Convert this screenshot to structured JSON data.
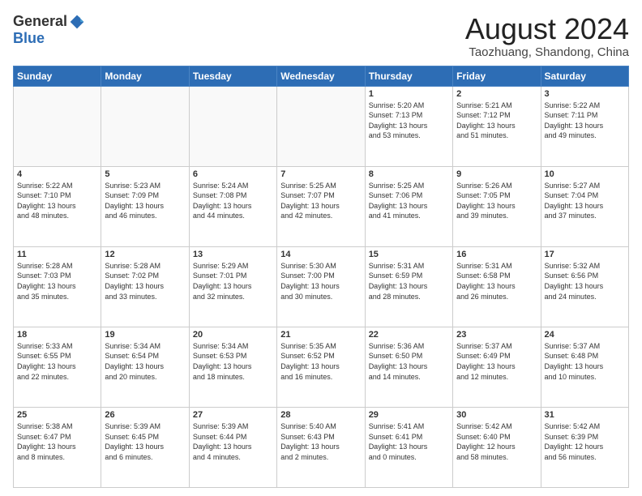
{
  "logo": {
    "general": "General",
    "blue": "Blue"
  },
  "title": "August 2024",
  "subtitle": "Taozhuang, Shandong, China",
  "headers": [
    "Sunday",
    "Monday",
    "Tuesday",
    "Wednesday",
    "Thursday",
    "Friday",
    "Saturday"
  ],
  "weeks": [
    [
      {
        "day": "",
        "info": ""
      },
      {
        "day": "",
        "info": ""
      },
      {
        "day": "",
        "info": ""
      },
      {
        "day": "",
        "info": ""
      },
      {
        "day": "1",
        "info": "Sunrise: 5:20 AM\nSunset: 7:13 PM\nDaylight: 13 hours\nand 53 minutes."
      },
      {
        "day": "2",
        "info": "Sunrise: 5:21 AM\nSunset: 7:12 PM\nDaylight: 13 hours\nand 51 minutes."
      },
      {
        "day": "3",
        "info": "Sunrise: 5:22 AM\nSunset: 7:11 PM\nDaylight: 13 hours\nand 49 minutes."
      }
    ],
    [
      {
        "day": "4",
        "info": "Sunrise: 5:22 AM\nSunset: 7:10 PM\nDaylight: 13 hours\nand 48 minutes."
      },
      {
        "day": "5",
        "info": "Sunrise: 5:23 AM\nSunset: 7:09 PM\nDaylight: 13 hours\nand 46 minutes."
      },
      {
        "day": "6",
        "info": "Sunrise: 5:24 AM\nSunset: 7:08 PM\nDaylight: 13 hours\nand 44 minutes."
      },
      {
        "day": "7",
        "info": "Sunrise: 5:25 AM\nSunset: 7:07 PM\nDaylight: 13 hours\nand 42 minutes."
      },
      {
        "day": "8",
        "info": "Sunrise: 5:25 AM\nSunset: 7:06 PM\nDaylight: 13 hours\nand 41 minutes."
      },
      {
        "day": "9",
        "info": "Sunrise: 5:26 AM\nSunset: 7:05 PM\nDaylight: 13 hours\nand 39 minutes."
      },
      {
        "day": "10",
        "info": "Sunrise: 5:27 AM\nSunset: 7:04 PM\nDaylight: 13 hours\nand 37 minutes."
      }
    ],
    [
      {
        "day": "11",
        "info": "Sunrise: 5:28 AM\nSunset: 7:03 PM\nDaylight: 13 hours\nand 35 minutes."
      },
      {
        "day": "12",
        "info": "Sunrise: 5:28 AM\nSunset: 7:02 PM\nDaylight: 13 hours\nand 33 minutes."
      },
      {
        "day": "13",
        "info": "Sunrise: 5:29 AM\nSunset: 7:01 PM\nDaylight: 13 hours\nand 32 minutes."
      },
      {
        "day": "14",
        "info": "Sunrise: 5:30 AM\nSunset: 7:00 PM\nDaylight: 13 hours\nand 30 minutes."
      },
      {
        "day": "15",
        "info": "Sunrise: 5:31 AM\nSunset: 6:59 PM\nDaylight: 13 hours\nand 28 minutes."
      },
      {
        "day": "16",
        "info": "Sunrise: 5:31 AM\nSunset: 6:58 PM\nDaylight: 13 hours\nand 26 minutes."
      },
      {
        "day": "17",
        "info": "Sunrise: 5:32 AM\nSunset: 6:56 PM\nDaylight: 13 hours\nand 24 minutes."
      }
    ],
    [
      {
        "day": "18",
        "info": "Sunrise: 5:33 AM\nSunset: 6:55 PM\nDaylight: 13 hours\nand 22 minutes."
      },
      {
        "day": "19",
        "info": "Sunrise: 5:34 AM\nSunset: 6:54 PM\nDaylight: 13 hours\nand 20 minutes."
      },
      {
        "day": "20",
        "info": "Sunrise: 5:34 AM\nSunset: 6:53 PM\nDaylight: 13 hours\nand 18 minutes."
      },
      {
        "day": "21",
        "info": "Sunrise: 5:35 AM\nSunset: 6:52 PM\nDaylight: 13 hours\nand 16 minutes."
      },
      {
        "day": "22",
        "info": "Sunrise: 5:36 AM\nSunset: 6:50 PM\nDaylight: 13 hours\nand 14 minutes."
      },
      {
        "day": "23",
        "info": "Sunrise: 5:37 AM\nSunset: 6:49 PM\nDaylight: 13 hours\nand 12 minutes."
      },
      {
        "day": "24",
        "info": "Sunrise: 5:37 AM\nSunset: 6:48 PM\nDaylight: 13 hours\nand 10 minutes."
      }
    ],
    [
      {
        "day": "25",
        "info": "Sunrise: 5:38 AM\nSunset: 6:47 PM\nDaylight: 13 hours\nand 8 minutes."
      },
      {
        "day": "26",
        "info": "Sunrise: 5:39 AM\nSunset: 6:45 PM\nDaylight: 13 hours\nand 6 minutes."
      },
      {
        "day": "27",
        "info": "Sunrise: 5:39 AM\nSunset: 6:44 PM\nDaylight: 13 hours\nand 4 minutes."
      },
      {
        "day": "28",
        "info": "Sunrise: 5:40 AM\nSunset: 6:43 PM\nDaylight: 13 hours\nand 2 minutes."
      },
      {
        "day": "29",
        "info": "Sunrise: 5:41 AM\nSunset: 6:41 PM\nDaylight: 13 hours\nand 0 minutes."
      },
      {
        "day": "30",
        "info": "Sunrise: 5:42 AM\nSunset: 6:40 PM\nDaylight: 12 hours\nand 58 minutes."
      },
      {
        "day": "31",
        "info": "Sunrise: 5:42 AM\nSunset: 6:39 PM\nDaylight: 12 hours\nand 56 minutes."
      }
    ]
  ]
}
